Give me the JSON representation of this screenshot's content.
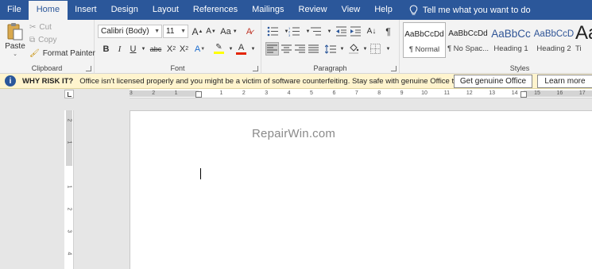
{
  "tabs": [
    {
      "label": "File",
      "active": false
    },
    {
      "label": "Home",
      "active": true
    },
    {
      "label": "Insert",
      "active": false
    },
    {
      "label": "Design",
      "active": false
    },
    {
      "label": "Layout",
      "active": false
    },
    {
      "label": "References",
      "active": false
    },
    {
      "label": "Mailings",
      "active": false
    },
    {
      "label": "Review",
      "active": false
    },
    {
      "label": "View",
      "active": false
    },
    {
      "label": "Help",
      "active": false
    }
  ],
  "tell_me": {
    "label": "Tell me what you want to do",
    "icon": "lightbulb-icon"
  },
  "clipboard": {
    "group_label": "Clipboard",
    "paste_label": "Paste",
    "cut_label": "Cut",
    "copy_label": "Copy",
    "format_painter_label": "Format Painter"
  },
  "font": {
    "group_label": "Font",
    "font_name": "Calibri (Body)",
    "font_size": "11",
    "grow_label": "A",
    "shrink_label": "A",
    "case_label": "Aa",
    "bold": "B",
    "italic": "I",
    "underline": "U",
    "strike": "abc",
    "subscript": "X",
    "superscript": "X",
    "text_effects": "A",
    "font_color": "A",
    "font_color_swatch": "#e32400",
    "highlight_swatch": "#ffff00"
  },
  "paragraph": {
    "group_label": "Paragraph"
  },
  "styles": {
    "group_label": "Styles",
    "items": [
      {
        "sample": "AaBbCcDd",
        "name": "¶ Normal"
      },
      {
        "sample": "AaBbCcDd",
        "name": "¶ No Spac..."
      },
      {
        "sample": "AaBbCc",
        "name": "Heading 1"
      },
      {
        "sample": "AaBbCcD",
        "name": "Heading 2"
      },
      {
        "sample": "Aa",
        "name": "Ti"
      }
    ],
    "heading_color": "#2f5496"
  },
  "notice": {
    "icon": "info-icon",
    "title": "WHY RISK IT?",
    "message": "Office isn't licensed properly and you might be a victim of software counterfeiting. Stay safe with genuine Office today.",
    "primary_button": "Get genuine Office",
    "secondary_button": "Learn more"
  },
  "ruler": {
    "top_ticks": [
      "3",
      "2",
      "1",
      "1",
      "2",
      "3",
      "4",
      "5",
      "6",
      "7",
      "8",
      "9",
      "10",
      "11",
      "12",
      "13",
      "14",
      "15",
      "16",
      "17"
    ],
    "left_ticks": [
      "2",
      "1",
      "1",
      "2",
      "3",
      "4"
    ]
  },
  "document": {
    "watermark": "RepairWin.com"
  },
  "colors": {
    "brand": "#2b579a",
    "notice_bg": "#fff4ce"
  }
}
